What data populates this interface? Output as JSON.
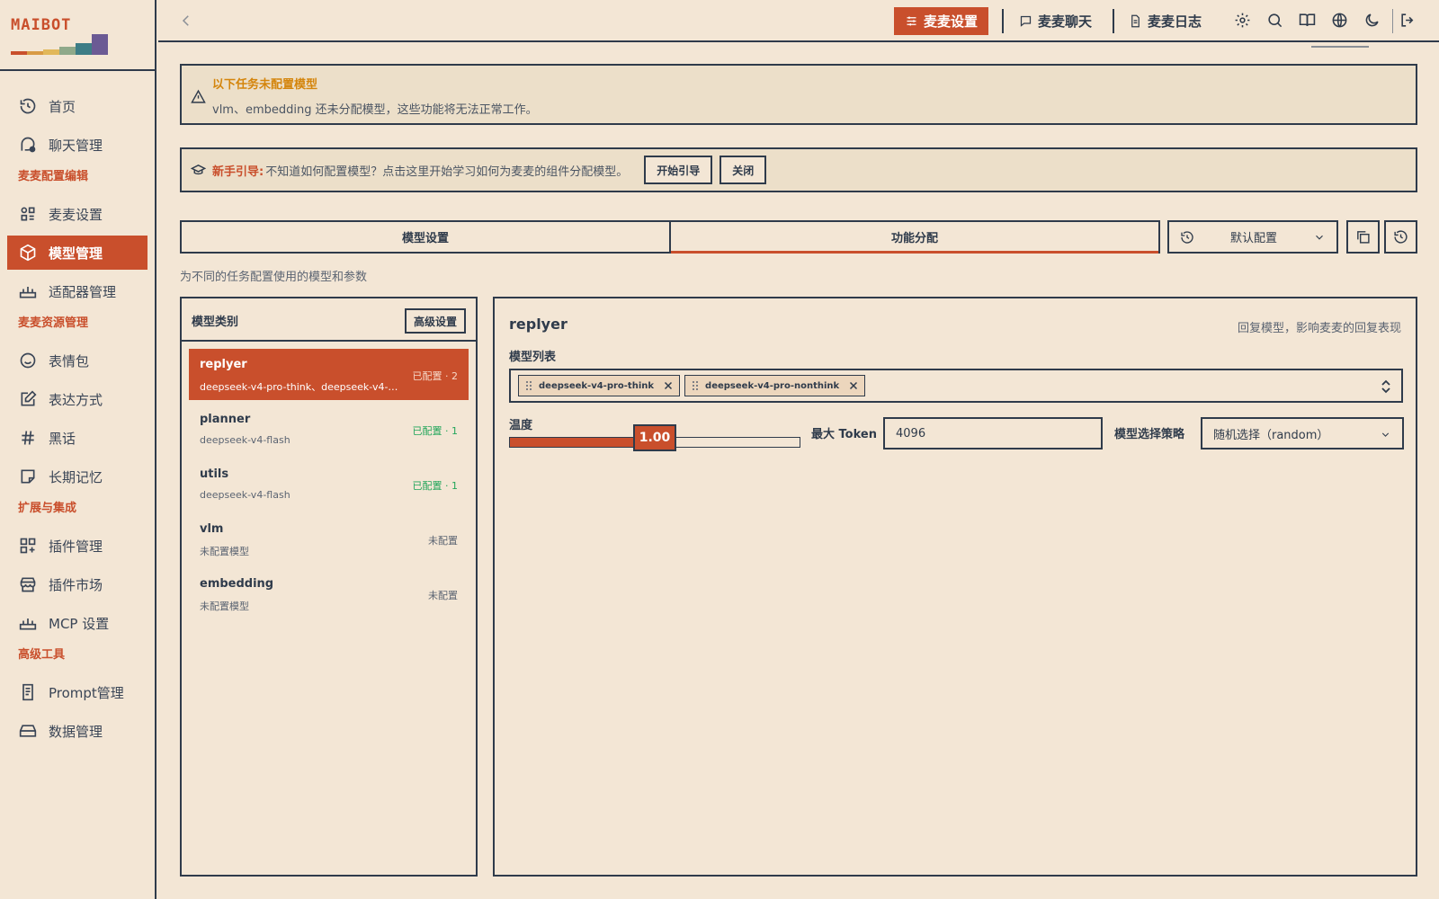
{
  "app": {
    "logo": "MAIBOT",
    "colors": {
      "accent": "#c94f2c",
      "ink": "#2f3b4b",
      "bg": "#f3e6d5",
      "warn": "#d4850c",
      "ok": "#22a55a"
    }
  },
  "sidebar": {
    "items": [
      {
        "label": "首页",
        "icon": "history-icon"
      },
      {
        "label": "聊天管理",
        "icon": "chat-icon"
      }
    ],
    "section1": "麦麦配置编辑",
    "items1": [
      {
        "label": "麦麦设置",
        "icon": "shapes-icon"
      },
      {
        "label": "模型管理",
        "icon": "cube-icon"
      },
      {
        "label": "适配器管理",
        "icon": "router-icon"
      }
    ],
    "section2": "麦麦资源管理",
    "items2": [
      {
        "label": "表情包",
        "icon": "smile-icon"
      },
      {
        "label": "表达方式",
        "icon": "edit-icon"
      },
      {
        "label": "黑话",
        "icon": "hash-icon"
      },
      {
        "label": "长期记忆",
        "icon": "memory-icon"
      }
    ],
    "section3": "扩展与集成",
    "items3": [
      {
        "label": "插件管理",
        "icon": "grid-plus-icon"
      },
      {
        "label": "插件市场",
        "icon": "store-icon"
      },
      {
        "label": "MCP 设置",
        "icon": "router-icon"
      }
    ],
    "section4": "高级工具",
    "items4": [
      {
        "label": "Prompt管理",
        "icon": "doc-icon"
      },
      {
        "label": "数据管理",
        "icon": "drive-icon"
      }
    ]
  },
  "topbar": {
    "tabs": [
      {
        "label": "麦麦设置",
        "icon": "sliders-icon"
      },
      {
        "label": "麦麦聊天",
        "icon": "message-icon"
      },
      {
        "label": "麦麦日志",
        "icon": "file-icon"
      }
    ]
  },
  "alert": {
    "title": "以下任务未配置模型",
    "desc": "vlm、embedding 还未分配模型，这些功能将无法正常工作。"
  },
  "guide": {
    "label": "新手引导:",
    "text": "不知道如何配置模型？点击这里开始学习如何为麦麦的组件分配模型。",
    "start": "开始引导",
    "close": "关闭"
  },
  "tabs": [
    "模型设置",
    "功能分配"
  ],
  "config_select": "默认配置",
  "subtitle": "为不同的任务配置使用的模型和参数",
  "categories": {
    "title": "模型类别",
    "advanced": "高级设置",
    "items": [
      {
        "name": "replyer",
        "models": "deepseek-v4-pro-think、deepseek-v4-…",
        "status": "已配置 · 2"
      },
      {
        "name": "planner",
        "models": "deepseek-v4-flash",
        "status": "已配置 · 1"
      },
      {
        "name": "utils",
        "models": "deepseek-v4-flash",
        "status": "已配置 · 1"
      },
      {
        "name": "vlm",
        "models": "未配置模型",
        "status": "未配置"
      },
      {
        "name": "embedding",
        "models": "未配置模型",
        "status": "未配置"
      }
    ]
  },
  "detail": {
    "title": "replyer",
    "desc": "回复模型，影响麦麦的回复表现",
    "model_list_label": "模型列表",
    "models": [
      "deepseek-v4-pro-think",
      "deepseek-v4-pro-nonthink"
    ],
    "temp_label": "温度",
    "temperature": "1.00",
    "temperature_fraction": 0.5,
    "max_token_label": "最大 Token",
    "max_token": "4096",
    "strategy_label": "模型选择策略",
    "strategy": "随机选择（random）"
  }
}
